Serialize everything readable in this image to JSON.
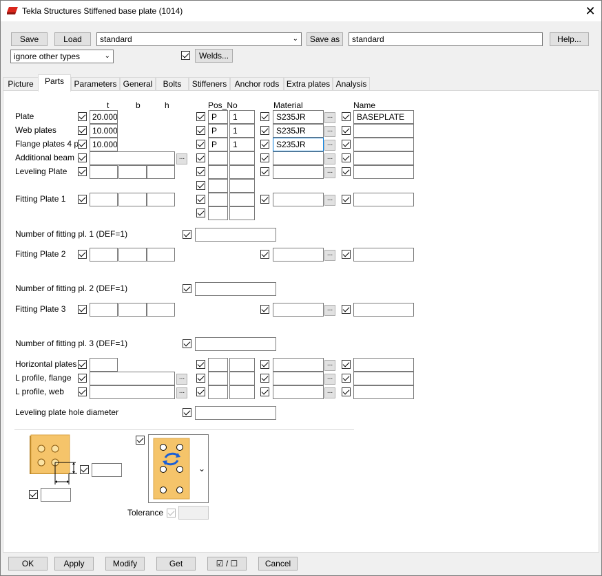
{
  "window": {
    "title": "Tekla Structures  Stiffened base plate (1014)"
  },
  "toolbar": {
    "save_label": "Save",
    "load_label": "Load",
    "preset_value": "standard",
    "save_as_label": "Save as",
    "save_as_value": "standard",
    "help_label": "Help...",
    "filter_value": "ignore other types",
    "welds_label": "Welds..."
  },
  "tabs": [
    {
      "label": "Picture"
    },
    {
      "label": "Parts"
    },
    {
      "label": "Parameters"
    },
    {
      "label": "General"
    },
    {
      "label": "Bolts"
    },
    {
      "label": "Stiffeners"
    },
    {
      "label": "Anchor rods"
    },
    {
      "label": "Extra plates"
    },
    {
      "label": "Analysis"
    }
  ],
  "columns": {
    "t": "t",
    "b": "b",
    "h": "h",
    "pos_no": "Pos_No",
    "material": "Material",
    "name": "Name"
  },
  "rows": {
    "plate": {
      "label": "Plate",
      "t": "20.000",
      "prefix": "P",
      "start": "1",
      "material": "S235JR",
      "name": "BASEPLATE"
    },
    "web_plates": {
      "label": "Web plates",
      "t": "10.000",
      "prefix": "P",
      "start": "1",
      "material": "S235JR",
      "name": ""
    },
    "flange_plates": {
      "label": "Flange plates 4 pc",
      "t": "10.000",
      "prefix": "P",
      "start": "1",
      "material": "S235JR",
      "name": ""
    },
    "additional_beam": {
      "label": "Additional beam"
    },
    "leveling_plate": {
      "label": "Leveling Plate"
    },
    "fitting_plate_1": {
      "label": "Fitting Plate 1"
    },
    "num_fitting_1": {
      "label": "Number of fitting pl. 1 (DEF=1)"
    },
    "fitting_plate_2": {
      "label": "Fitting Plate 2"
    },
    "num_fitting_2": {
      "label": "Number of fitting pl. 2 (DEF=1)"
    },
    "fitting_plate_3": {
      "label": "Fitting Plate 3"
    },
    "num_fitting_3": {
      "label": "Number of fitting pl. 3 (DEF=1)"
    },
    "horizontal_plates": {
      "label": "Horizontal plates"
    },
    "l_profile_flange": {
      "label": "L profile, flange"
    },
    "l_profile_web": {
      "label": "L profile, web"
    },
    "leveling_hole": {
      "label": "Leveling plate hole diameter"
    }
  },
  "picture_area": {
    "tolerance_label": "Tolerance"
  },
  "footer": {
    "ok_label": "OK",
    "apply_label": "Apply",
    "modify_label": "Modify",
    "get_label": "Get",
    "toggle_label": "☑ / ☐",
    "cancel_label": "Cancel"
  },
  "colors": {
    "plate_fill": "#f5c46a",
    "plate_edge": "#b07a1a",
    "icon_blue": "#1a5fd6",
    "app_icon_red": "#d9261c"
  }
}
